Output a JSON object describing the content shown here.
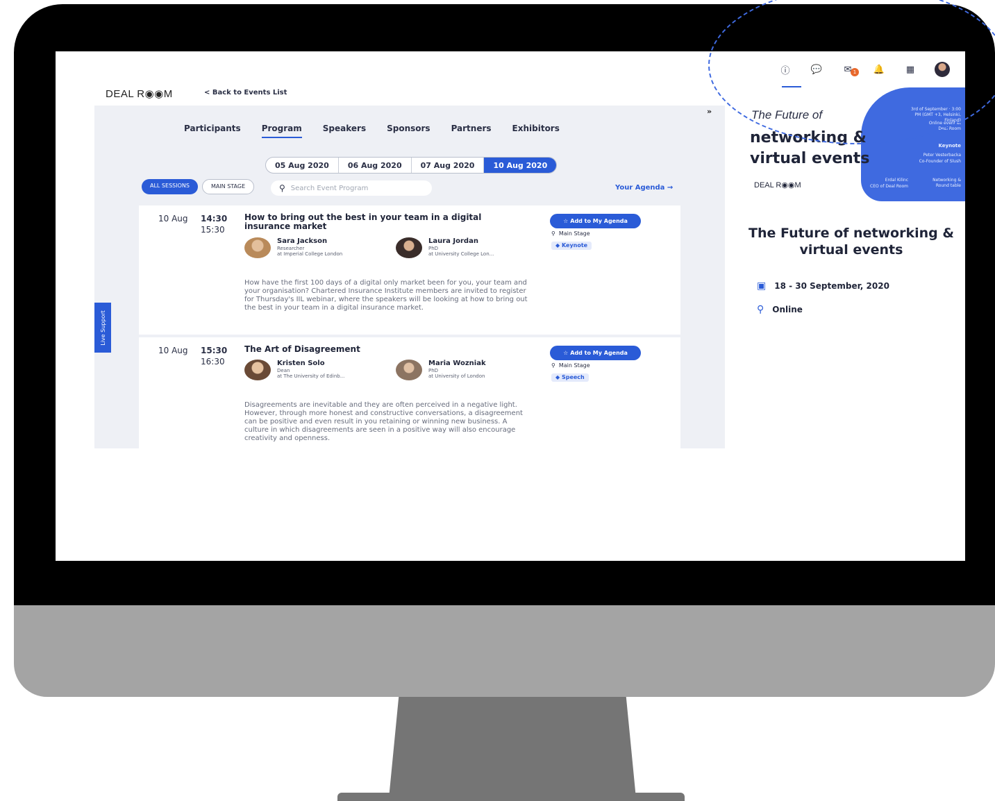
{
  "header": {
    "logo": "DEAL R◉◉M",
    "back_link": "< Back to Events List"
  },
  "tabs": [
    "Participants",
    "Program",
    "Speakers",
    "Sponsors",
    "Partners",
    "Exhibitors"
  ],
  "active_tab": "Program",
  "dates": [
    "05 Aug 2020",
    "06 Aug 2020",
    "07 Aug 2020",
    "10 Aug 2020"
  ],
  "active_date": "10 Aug 2020",
  "filters": {
    "all_sessions": "ALL SESSIONS",
    "main_stage": "MAIN STAGE",
    "search_placeholder": "Search Event Program",
    "your_agenda": "Your Agenda →"
  },
  "sessions": [
    {
      "date": "10 Aug",
      "start": "14:30",
      "end": "15:30",
      "title": "How to bring out the best in your team in a digital insurance market",
      "speakers": [
        {
          "name": "Sara Jackson",
          "role": "Researcher",
          "org": "at Imperial College London"
        },
        {
          "name": "Laura Jordan",
          "role": "PhD",
          "org": "at University College Lon..."
        }
      ],
      "description": "How have the first 100 days of a digital only market been for you, your team and your organisation? Chartered Insurance Institute members are invited to register for Thursday's IIL webinar, where the speakers will be looking at how to bring out the best in your team in a digital insurance market.",
      "add_button": "Add to My Agenda",
      "stage": "Main Stage",
      "tag": "Keynote"
    },
    {
      "date": "10 Aug",
      "start": "15:30",
      "end": "16:30",
      "title": "The Art of Disagreement",
      "speakers": [
        {
          "name": "Kristen Solo",
          "role": "Dean",
          "org": "at The University of Edinb..."
        },
        {
          "name": "Maria Wozniak",
          "role": "PhD",
          "org": "at University of London"
        }
      ],
      "description": "Disagreements are inevitable and they are often perceived in a negative light. However, through more honest and constructive conversations, a disagreement can be positive and even result in you retaining or winning new business. A culture in which disagreements are seen in a positive way will also encourage creativity and openness.",
      "add_button": "Add to My Agenda",
      "stage": "Main Stage",
      "tag": "Speech"
    }
  ],
  "live_support": "Live Support",
  "icon_bar": {
    "icons": [
      "info-icon",
      "chat-icon",
      "meetings-icon",
      "bell-icon",
      "calendar-icon",
      "user-avatar"
    ],
    "meetings_badge": "1"
  },
  "banner": {
    "line1": "The Future of",
    "line2": "networking &",
    "line3": "virtual events",
    "logo": "DEAL R◉◉M",
    "info1": "3rd of September · 3:00 PM (GMT +3, Helsinki, Finland)",
    "info2": "Online event at Deal Room",
    "keynote_label": "Keynote",
    "keynote_speaker": "Peter Vesterbacka",
    "keynote_role": "Co-Founder of Slush",
    "host": "Erdal Kilinc",
    "host_role": "CEO of Deal Room",
    "format": "Networking & Round table"
  },
  "event": {
    "title": "The Future of networking & virtual events",
    "dates": "18 - 30 September, 2020",
    "location": "Online"
  },
  "colors": {
    "accent": "#2a5bd7",
    "badge": "#e8682c",
    "panel_bg": "#eef0f5"
  }
}
